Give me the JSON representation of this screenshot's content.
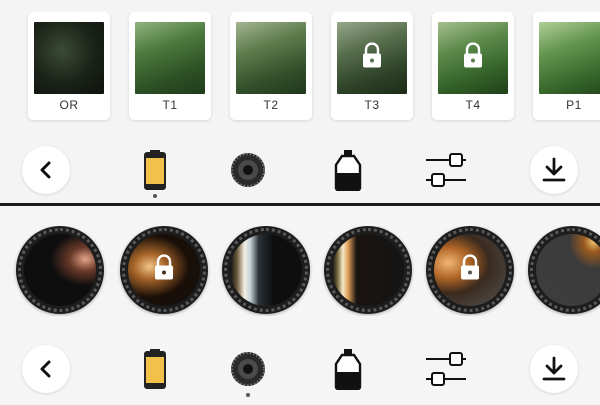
{
  "filters": [
    {
      "label": "OR",
      "locked": false,
      "tint": "#1f2b1c"
    },
    {
      "label": "T1",
      "locked": false,
      "tint": "#3e6a34"
    },
    {
      "label": "T2",
      "locked": false,
      "tint": "#3d5e35"
    },
    {
      "label": "T3",
      "locked": true,
      "tint": "#3a5838"
    },
    {
      "label": "T4",
      "locked": true,
      "tint": "#3c6a3a"
    },
    {
      "label": "P1",
      "locked": false,
      "tint": "#3e6e3a"
    }
  ],
  "lenses": [
    {
      "locked": false
    },
    {
      "locked": true
    },
    {
      "locked": false
    },
    {
      "locked": false
    },
    {
      "locked": true
    },
    {
      "locked": false
    }
  ],
  "toolbar_icons": [
    "back-icon",
    "film-roll-icon",
    "lens-icon",
    "bottle-icon",
    "adjust-sliders-icon",
    "download-icon"
  ],
  "colors": {
    "film_yellow": "#f2c14a",
    "lens_dark": "#1d1d1d",
    "accent_text": "#333333"
  }
}
